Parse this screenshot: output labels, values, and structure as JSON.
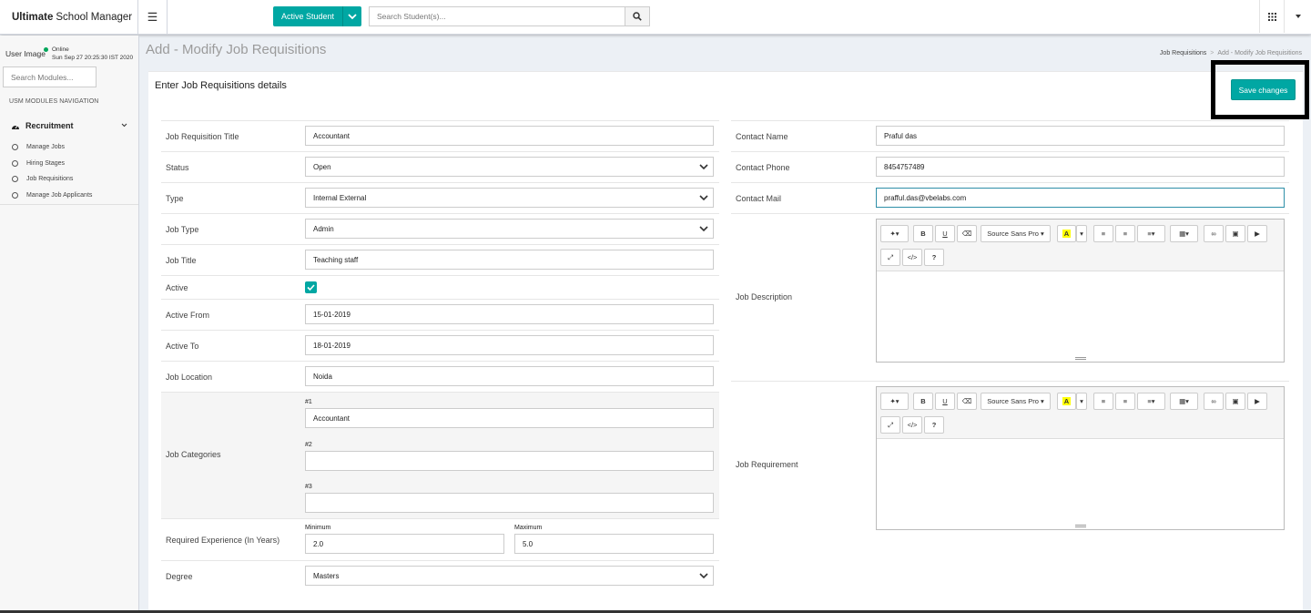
{
  "app": {
    "brand_bold": "Ultimate",
    "brand_rest": "School Manager"
  },
  "topbar": {
    "student_filter": "Active Student",
    "search_placeholder": "Search Student(s)..."
  },
  "sidebar": {
    "user_image_alt": "User Image",
    "status": "Online",
    "datetime": "Sun Sep 27 20:25:30 IST 2020",
    "search_placeholder": "Search Modules...",
    "nav_header": "USM MODULES NAVIGATION",
    "group": "Recruitment",
    "items": [
      "Manage Jobs",
      "Hiring Stages",
      "Job Requisitions",
      "Manage Job Applicants"
    ]
  },
  "page": {
    "title": "Add - Modify Job Requisitions",
    "breadcrumb": [
      "Job Requisitions",
      "Add - Modify Job Requisitions"
    ],
    "box_title": "Enter Job Requisitions details",
    "save_label": "Save changes"
  },
  "form_left": {
    "job_requisition_title": {
      "label": "Job Requisition Title",
      "value": "Accountant"
    },
    "status": {
      "label": "Status",
      "value": "Open"
    },
    "type": {
      "label": "Type",
      "value": "Internal External"
    },
    "job_type": {
      "label": "Job Type",
      "value": "Admin"
    },
    "job_title": {
      "label": "Job Title",
      "value": "Teaching staff"
    },
    "active": {
      "label": "Active",
      "checked": true
    },
    "active_from": {
      "label": "Active From",
      "value": "15-01-2019"
    },
    "active_to": {
      "label": "Active To",
      "value": "18-01-2019"
    },
    "job_location": {
      "label": "Job Location",
      "value": "Noida"
    },
    "job_categories": {
      "label": "Job Categories",
      "items": [
        {
          "tag": "#1",
          "value": "Accountant"
        },
        {
          "tag": "#2",
          "value": ""
        },
        {
          "tag": "#3",
          "value": ""
        }
      ]
    },
    "required_experience": {
      "label": "Required Experience (In Years)",
      "min_label": "Minimum",
      "min_value": "2.0",
      "max_label": "Maximum",
      "max_value": "5.0"
    },
    "degree": {
      "label": "Degree",
      "value": "Masters"
    }
  },
  "form_right": {
    "contact_name": {
      "label": "Contact Name",
      "value": "Praful das"
    },
    "contact_phone": {
      "label": "Contact Phone",
      "value": "8454757489"
    },
    "contact_mail": {
      "label": "Contact Mail",
      "value": "prafful.das@vbelabs.com"
    },
    "job_description": {
      "label": "Job Description"
    },
    "job_requirement": {
      "label": "Job Requirement"
    }
  },
  "editor": {
    "font_name": "Source Sans Pro"
  },
  "colors": {
    "accent": "#00a7a3",
    "focus_border": "#2e8fa8"
  }
}
